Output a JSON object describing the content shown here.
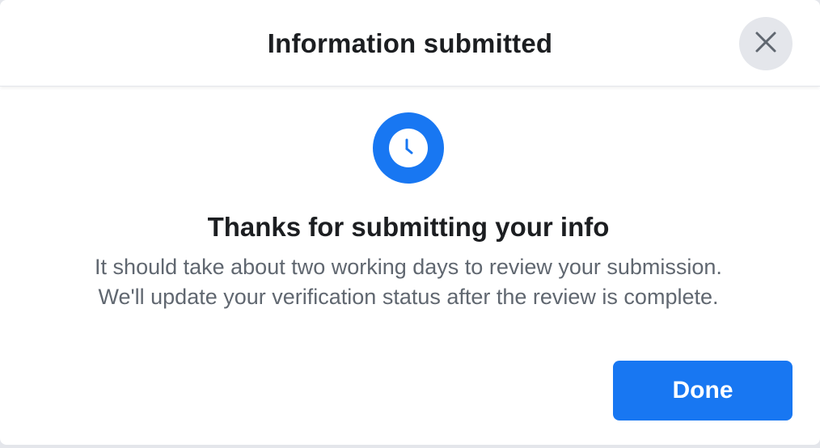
{
  "dialog": {
    "title": "Information submitted",
    "close_icon": "close-icon",
    "status_icon": "clock-icon",
    "heading": "Thanks for submitting your info",
    "message_lines": [
      "It should take about two working days to review your submission.",
      "We'll update your verification status after the review is complete."
    ],
    "done_label": "Done"
  },
  "colors": {
    "accent": "#1877f2",
    "heading_text": "#1c1e21",
    "body_text": "#606770",
    "close_bg": "#e4e6eb"
  }
}
